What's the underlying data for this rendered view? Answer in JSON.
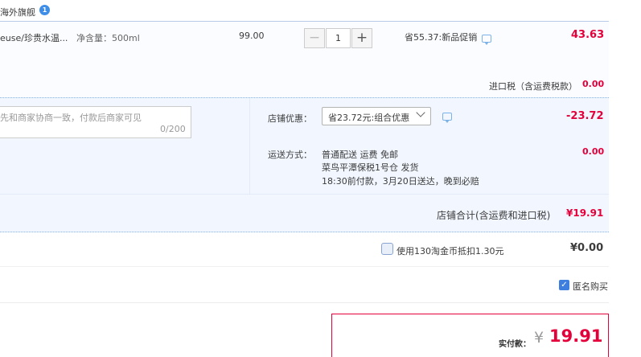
{
  "store": {
    "name": "海外旗舰",
    "badge": "1"
  },
  "item": {
    "name": "euse/珍贵水温...",
    "spec": "净含量：500ml",
    "unit_price": "99.00",
    "quantity": "1",
    "minus": "−",
    "plus": "+",
    "promo": "省55.37:新品促销",
    "total": "43.63"
  },
  "tax": {
    "label": "进口税（含运费税款）",
    "value": "0.00"
  },
  "memo": {
    "placeholder": "先和商家协商一致，付款后商家可见",
    "count": "0/200"
  },
  "discount": {
    "label": "店铺优惠：",
    "selected": "省23.72元:组合优惠",
    "amount": "-23.72"
  },
  "shipping": {
    "label": "运送方式：",
    "line1": "普通配送 运费 免邮",
    "line2": "菜鸟平潭保税1号仓   发货",
    "line3": "18:30前付款，3月20日送达，晚到必赔",
    "fee": "0.00"
  },
  "subtotal": {
    "label": "店铺合计(含运费和进口税)",
    "value": "¥19.91"
  },
  "coins": {
    "label": "使用130淘金币抵扣1.30元",
    "value": "¥0.00"
  },
  "anonymous": {
    "label": "匿名购买",
    "check": "✓"
  },
  "payment": {
    "label": "实付款：",
    "currency": "¥",
    "amount": "19.91"
  },
  "colors": {
    "accent": "#e4003a",
    "link_blue": "#3e8ee8"
  },
  "icons": [
    "chat-icon",
    "chevron-down-icon",
    "checkbox-icon"
  ]
}
